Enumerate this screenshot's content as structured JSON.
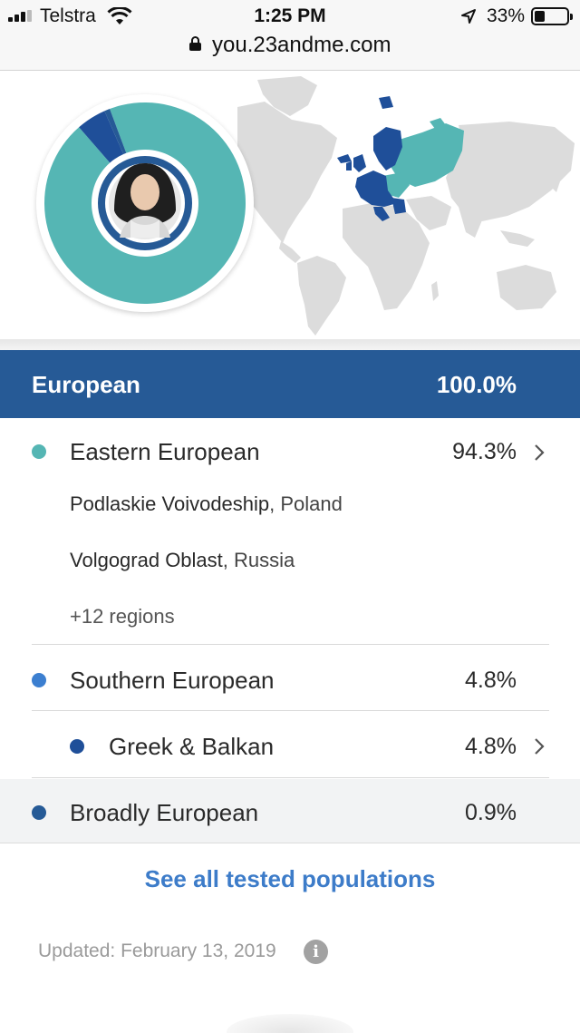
{
  "status_bar": {
    "carrier": "Telstra",
    "time": "1:25 PM",
    "battery_percent": "33%",
    "battery_level": 0.33,
    "icons": [
      "signal-icon",
      "wifi-icon",
      "location-arrow-icon",
      "battery-icon"
    ]
  },
  "browser": {
    "url": "you.23andme.com",
    "icons": [
      "lock-icon"
    ]
  },
  "colors": {
    "teal": "#55b6b4",
    "dark_blue": "#1f4f99",
    "medium_blue": "#3c7fd0",
    "header_blue": "#265a96",
    "link_blue": "#3d7cc9"
  },
  "summary": {
    "region": "European",
    "percent": "100.0%"
  },
  "breakdown": {
    "eastern": {
      "label": "Eastern European",
      "percent": "94.3%",
      "subregions": [
        {
          "name": "Podlaskie Voivodeship",
          "country": ", Poland"
        },
        {
          "name": "Volgograd Oblast",
          "country": ", Russia"
        }
      ],
      "more": "+12 regions"
    },
    "southern": {
      "label": "Southern European",
      "percent": "4.8%",
      "children": [
        {
          "label": "Greek & Balkan",
          "percent": "4.8%"
        }
      ]
    },
    "broadly": {
      "label": "Broadly European",
      "percent": "0.9%"
    }
  },
  "ancestry_shares": [
    {
      "name": "Eastern European",
      "value": 94.3,
      "color": "#55b6b4"
    },
    {
      "name": "Southern European",
      "value": 4.8,
      "color": "#1f4f99"
    },
    {
      "name": "Broadly European",
      "value": 0.9,
      "color": "#265a96"
    }
  ],
  "see_all_link": "See all tested populations",
  "updated": "Updated: February 13, 2019",
  "info_glyph": "i"
}
